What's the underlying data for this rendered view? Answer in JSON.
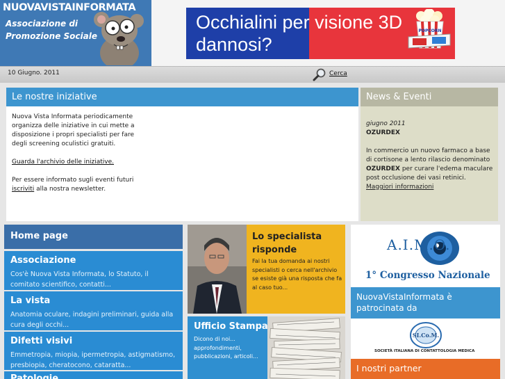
{
  "header": {
    "site_name": "NUOVAVISTAINFORMATA",
    "subtitle_1": "Associazione di",
    "subtitle_2": "Promozione Sociale",
    "banner_line_1": "Occhialini per visione 3D",
    "banner_line_2": "dannosi?",
    "banner_box_text": "POPCORN"
  },
  "bar": {
    "date": "10 Giugno. 2011",
    "search_label": "Cerca"
  },
  "iniziative": {
    "title": "Le nostre iniziative",
    "text": "Nuova Vista Informata periodicamente organizza delle iniziative in cui mette a disposizione i propri specialisti per fare degli screening oculistici gratuiti.",
    "archive_link": "Guarda l'archivio delle iniziative.",
    "newsletter_prefix": "Per essere informato sugli eventi futuri",
    "newsletter_link": "iscriviti",
    "newsletter_suffix": " alla nostra newsletter."
  },
  "news": {
    "title": "News & Eventi",
    "date": "giugno 2011",
    "headline": "OZURDEX",
    "text_1": "In commercio un nuovo farmaco a base di cortisone a lento rilascio denominato ",
    "text_bold": "OZURDEX",
    "text_2": " per curare l'edema maculare post occlusione dei vasi retinici.",
    "more_link": "Maggiori informazioni"
  },
  "menu": {
    "home": "Home page",
    "items": [
      {
        "title": "Associazione",
        "desc": "Cos'è Nuova Vista Informata, lo Statuto, il comitato scientifico, contatti..."
      },
      {
        "title": "La vista",
        "desc": "Anatomia oculare, indagini preliminari, guida alla cura degli occhi..."
      },
      {
        "title": "Difetti visivi",
        "desc": "Emmetropia, miopia, ipermetropia, astigmatismo, presbiopia, cheratocono, cataratta..."
      },
      {
        "title": "Patologie",
        "desc": ""
      }
    ]
  },
  "specialista": {
    "title_1": "Lo specialista",
    "title_2": "risponde",
    "desc": "Fai la tua domanda ai nostri specialisti o cerca nell'archivio se esiste già una risposta che fa al caso tuo..."
  },
  "stampa": {
    "title": "Ufficio Stampa",
    "desc": "Dicono di noi... approfondimenti, pubblicazioni, articoli..."
  },
  "aimo": {
    "logo": "A.I.M.O.",
    "congress": "1° Congresso Nazionale"
  },
  "patrocinio": {
    "line_1": "NuovaVistaInformata è",
    "line_2": "patrocinata da"
  },
  "sicom": {
    "name": "SOCIETÀ ITALIANA DI CONTATTOLOGIA MEDICA",
    "logo_text": "SI.Co.M."
  },
  "partner": {
    "title": "I nostri partner"
  },
  "colors": {
    "blue": "#2a8cd3",
    "dark_blue": "#3a6ea8",
    "yellow": "#f0b41f",
    "orange": "#e86c27",
    "khaki": "#b7b7a3"
  }
}
